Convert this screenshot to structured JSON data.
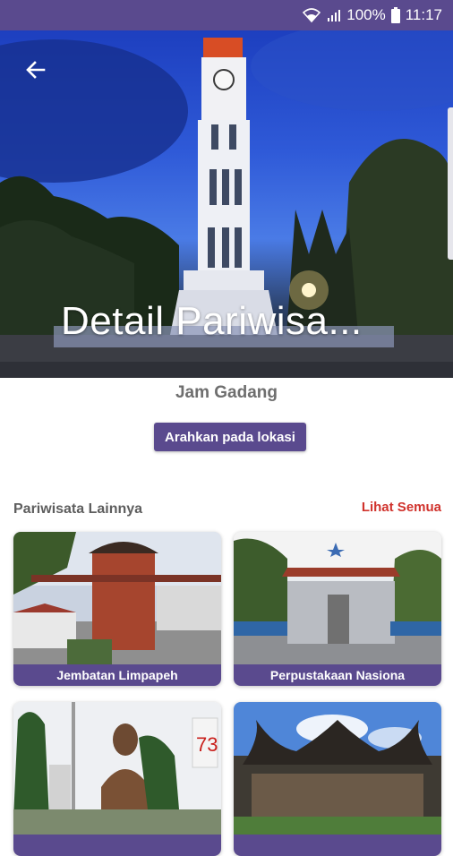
{
  "status_bar": {
    "battery": "100%",
    "time": "11:17",
    "icons": [
      "wifi-icon",
      "signal-icon",
      "battery-icon"
    ]
  },
  "header": {
    "title": "Detail Pariwisa...",
    "back_icon": "arrow-left-icon"
  },
  "detail": {
    "place_name": "Jam Gadang",
    "direction_button": "Arahkan pada lokasi"
  },
  "section": {
    "title": "Pariwisata Lainnya",
    "see_all": "Lihat Semua"
  },
  "cards": [
    {
      "label": "Jembatan Limpapeh"
    },
    {
      "label": "Perpustakaan Nasiona"
    },
    {
      "label": ""
    },
    {
      "label": ""
    }
  ],
  "colors": {
    "primary": "#5a4a8e",
    "accent": "#d0322c",
    "text_muted": "#6e6e6e"
  }
}
